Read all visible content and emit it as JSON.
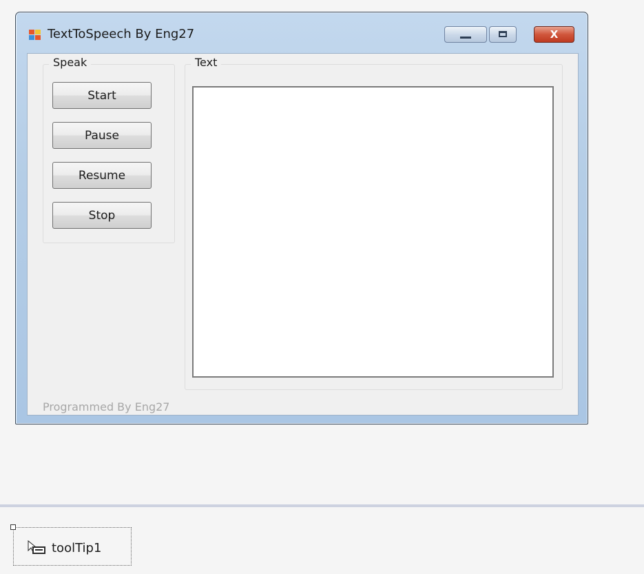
{
  "window": {
    "title": "TextToSpeech By Eng27",
    "icon": "winforms-app-icon",
    "controls": {
      "minimize_icon": "minimize-icon",
      "maximize_icon": "maximize-icon",
      "close_glyph": "X"
    }
  },
  "speak_group": {
    "caption": "Speak",
    "buttons": [
      {
        "label": "Start"
      },
      {
        "label": "Pause"
      },
      {
        "label": "Resume"
      },
      {
        "label": "Stop"
      }
    ]
  },
  "text_group": {
    "caption": "Text",
    "textbox_value": ""
  },
  "footer": {
    "label": "Programmed By Eng27"
  },
  "component_tray": {
    "items": [
      {
        "label": "toolTip1",
        "icon": "tooltip-component-icon"
      }
    ]
  },
  "colors": {
    "close_button": "#c9442a",
    "window_frame": "#b4cde6",
    "footer_text": "#a7a7a7"
  }
}
